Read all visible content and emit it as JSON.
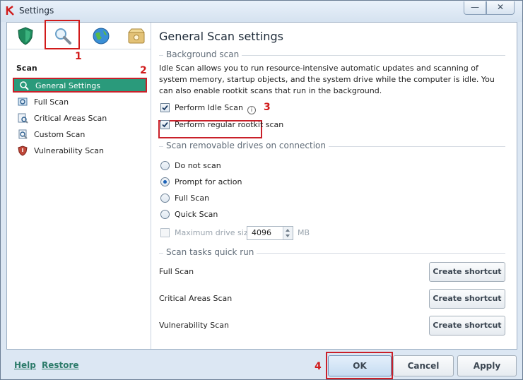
{
  "window": {
    "title": "Settings",
    "minimize": "—",
    "close": "✕"
  },
  "toolbar": {
    "icons": [
      "protection-icon",
      "scan-icon",
      "update-icon",
      "advanced-icon"
    ],
    "annotation": "1"
  },
  "sidebar": {
    "section_title": "Scan",
    "annotation": "2",
    "items": [
      {
        "label": "General Settings",
        "icon": "magnifier-icon",
        "active": true
      },
      {
        "label": "Full Scan",
        "icon": "full-scan-icon"
      },
      {
        "label": "Critical Areas Scan",
        "icon": "critical-areas-icon"
      },
      {
        "label": "Custom Scan",
        "icon": "custom-scan-icon"
      },
      {
        "label": "Vulnerability Scan",
        "icon": "vulnerability-icon"
      }
    ]
  },
  "main": {
    "title": "General Scan settings",
    "background_scan": {
      "group_label": "Background scan",
      "description": "Idle Scan allows you to run resource-intensive automatic updates and scanning of system memory, startup objects, and the system drive while the computer is idle. You can also enable rootkit scans that run in the background.",
      "idle_scan_label": "Perform Idle Scan",
      "idle_scan_checked": true,
      "idle_annotation": "3",
      "rootkit_label": "Perform regular rootkit scan",
      "rootkit_checked": true
    },
    "removable": {
      "group_label": "Scan removable drives on connection",
      "options": [
        {
          "label": "Do not scan",
          "selected": false
        },
        {
          "label": "Prompt for action",
          "selected": true
        },
        {
          "label": "Full Scan",
          "selected": false
        },
        {
          "label": "Quick Scan",
          "selected": false
        }
      ],
      "max_size_label": "Maximum drive size:",
      "max_size_value": "4096",
      "max_size_unit": "MB",
      "max_size_enabled": false
    },
    "quick_run": {
      "group_label": "Scan tasks quick run",
      "tasks": [
        {
          "label": "Full Scan",
          "button": "Create shortcut"
        },
        {
          "label": "Critical Areas Scan",
          "button": "Create shortcut"
        },
        {
          "label": "Vulnerability Scan",
          "button": "Create shortcut"
        }
      ]
    }
  },
  "footer": {
    "help": "Help",
    "restore": "Restore",
    "ok": "OK",
    "cancel": "Cancel",
    "apply": "Apply",
    "ok_annotation": "4"
  },
  "colors": {
    "accent": "#2a9a7b",
    "highlight_border": "#c9202a",
    "link": "#2c7b6a"
  }
}
